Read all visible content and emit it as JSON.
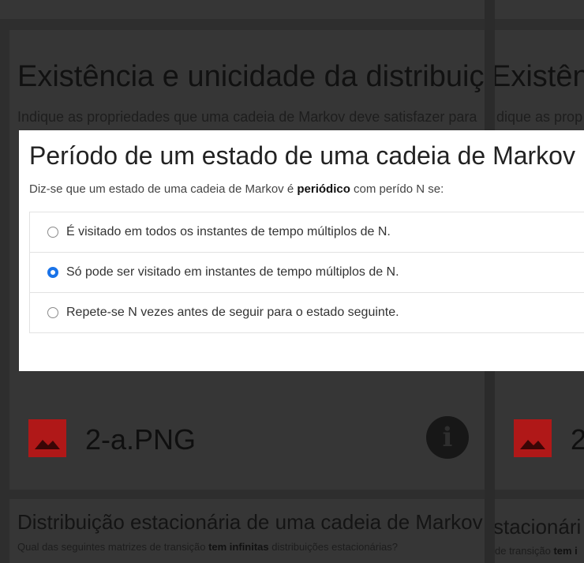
{
  "background": {
    "left_card": {
      "title": "Existência e unicidade da distribuição",
      "subtitle": "Indique as propriedades que uma cadeia de Markov deve satisfazer para",
      "file_name": "2-a.PNG",
      "info_icon": "info-icon",
      "file_icon": "image-icon"
    },
    "right_card": {
      "title": "Existên",
      "subtitle": "dique as prop",
      "file_name_partial": "2"
    },
    "bottom_left": {
      "title": "Distribuição estacionária de uma cadeia de Markov",
      "subtitle_pre": "Qual das seguintes matrizes de transição ",
      "subtitle_bold": "tem infinitas",
      "subtitle_post": " distribuições estacionárias?"
    },
    "bottom_right": {
      "title": "stacionári",
      "subtitle_pre": "de transição ",
      "subtitle_bold": "tem i"
    }
  },
  "modal": {
    "title": "Período de um estado de uma cadeia de Markov",
    "description_pre": "Diz-se que um estado de uma cadeia de Markov é ",
    "description_bold": "periódico",
    "description_post": " com perído N se:",
    "options": [
      {
        "label": "É visitado em todos os instantes de tempo múltiplos de N.",
        "selected": false
      },
      {
        "label": "Só pode ser visitado em instantes de tempo múltiplos de N.",
        "selected": true
      },
      {
        "label": "Repete-se N vezes antes de seguir para o estado seguinte.",
        "selected": false
      }
    ]
  },
  "colors": {
    "accent": "#1a73e8",
    "file_icon": "#b01818"
  }
}
